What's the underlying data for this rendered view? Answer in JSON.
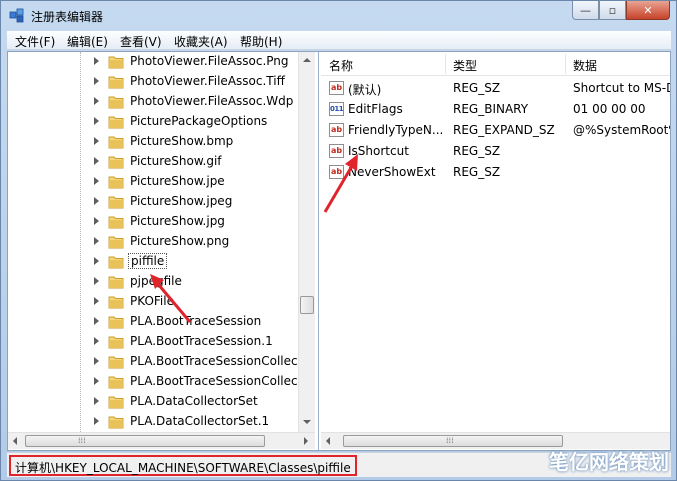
{
  "window": {
    "title": "注册表编辑器",
    "minimize": "—",
    "maximize": "▫",
    "close": "✕"
  },
  "menu": [
    "文件(F)",
    "编辑(E)",
    "查看(V)",
    "收藏夹(A)",
    "帮助(H)"
  ],
  "tree": {
    "items": [
      "PhotoViewer.FileAssoc.Png",
      "PhotoViewer.FileAssoc.Tiff",
      "PhotoViewer.FileAssoc.Wdp",
      "PicturePackageOptions",
      "PictureShow.bmp",
      "PictureShow.gif",
      "PictureShow.jpe",
      "PictureShow.jpeg",
      "PictureShow.jpg",
      "PictureShow.png",
      "piffile",
      "pjpegfile",
      "PKOFile",
      "PLA.BootTraceSession",
      "PLA.BootTraceSession.1",
      "PLA.BootTraceSessionCollect",
      "PLA.BootTraceSessionCollect",
      "PLA.DataCollectorSet",
      "PLA.DataCollectorSet.1"
    ],
    "selected_index": 10
  },
  "list": {
    "headers": [
      "名称",
      "类型",
      "数据"
    ],
    "rows": [
      {
        "icon": "string-value-icon",
        "name": "(默认)",
        "type": "REG_SZ",
        "data": "Shortcut to MS-D"
      },
      {
        "icon": "binary-value-icon",
        "name": "EditFlags",
        "type": "REG_BINARY",
        "data": "01 00 00 00"
      },
      {
        "icon": "string-value-icon",
        "name": "FriendlyTypeN...",
        "type": "REG_EXPAND_SZ",
        "data": "@%SystemRoot%"
      },
      {
        "icon": "string-value-icon",
        "name": "IsShortcut",
        "type": "REG_SZ",
        "data": ""
      },
      {
        "icon": "string-value-icon",
        "name": "NeverShowExt",
        "type": "REG_SZ",
        "data": ""
      }
    ]
  },
  "status": {
    "path": "计算机\\HKEY_LOCAL_MACHINE\\SOFTWARE\\Classes\\piffile"
  },
  "watermark": "笔亿网络策划",
  "colors": {
    "annotation": "#e0242c",
    "folder": "#e9c25a"
  }
}
